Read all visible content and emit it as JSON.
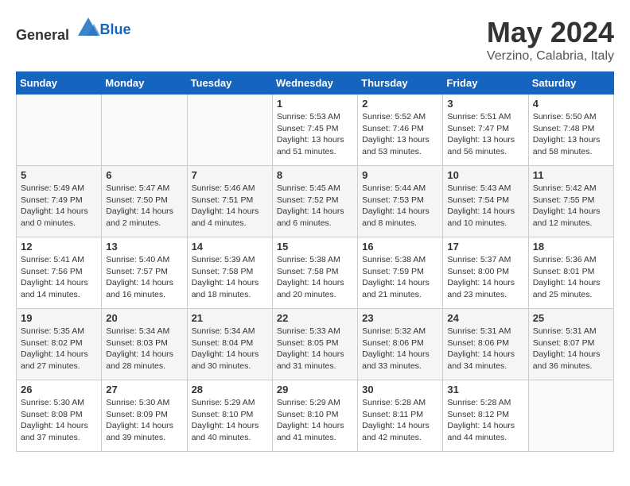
{
  "header": {
    "logo_general": "General",
    "logo_blue": "Blue",
    "month": "May 2024",
    "location": "Verzino, Calabria, Italy"
  },
  "days_of_week": [
    "Sunday",
    "Monday",
    "Tuesday",
    "Wednesday",
    "Thursday",
    "Friday",
    "Saturday"
  ],
  "weeks": [
    [
      {
        "day": "",
        "info": ""
      },
      {
        "day": "",
        "info": ""
      },
      {
        "day": "",
        "info": ""
      },
      {
        "day": "1",
        "info": "Sunrise: 5:53 AM\nSunset: 7:45 PM\nDaylight: 13 hours\nand 51 minutes."
      },
      {
        "day": "2",
        "info": "Sunrise: 5:52 AM\nSunset: 7:46 PM\nDaylight: 13 hours\nand 53 minutes."
      },
      {
        "day": "3",
        "info": "Sunrise: 5:51 AM\nSunset: 7:47 PM\nDaylight: 13 hours\nand 56 minutes."
      },
      {
        "day": "4",
        "info": "Sunrise: 5:50 AM\nSunset: 7:48 PM\nDaylight: 13 hours\nand 58 minutes."
      }
    ],
    [
      {
        "day": "5",
        "info": "Sunrise: 5:49 AM\nSunset: 7:49 PM\nDaylight: 14 hours\nand 0 minutes."
      },
      {
        "day": "6",
        "info": "Sunrise: 5:47 AM\nSunset: 7:50 PM\nDaylight: 14 hours\nand 2 minutes."
      },
      {
        "day": "7",
        "info": "Sunrise: 5:46 AM\nSunset: 7:51 PM\nDaylight: 14 hours\nand 4 minutes."
      },
      {
        "day": "8",
        "info": "Sunrise: 5:45 AM\nSunset: 7:52 PM\nDaylight: 14 hours\nand 6 minutes."
      },
      {
        "day": "9",
        "info": "Sunrise: 5:44 AM\nSunset: 7:53 PM\nDaylight: 14 hours\nand 8 minutes."
      },
      {
        "day": "10",
        "info": "Sunrise: 5:43 AM\nSunset: 7:54 PM\nDaylight: 14 hours\nand 10 minutes."
      },
      {
        "day": "11",
        "info": "Sunrise: 5:42 AM\nSunset: 7:55 PM\nDaylight: 14 hours\nand 12 minutes."
      }
    ],
    [
      {
        "day": "12",
        "info": "Sunrise: 5:41 AM\nSunset: 7:56 PM\nDaylight: 14 hours\nand 14 minutes."
      },
      {
        "day": "13",
        "info": "Sunrise: 5:40 AM\nSunset: 7:57 PM\nDaylight: 14 hours\nand 16 minutes."
      },
      {
        "day": "14",
        "info": "Sunrise: 5:39 AM\nSunset: 7:58 PM\nDaylight: 14 hours\nand 18 minutes."
      },
      {
        "day": "15",
        "info": "Sunrise: 5:38 AM\nSunset: 7:58 PM\nDaylight: 14 hours\nand 20 minutes."
      },
      {
        "day": "16",
        "info": "Sunrise: 5:38 AM\nSunset: 7:59 PM\nDaylight: 14 hours\nand 21 minutes."
      },
      {
        "day": "17",
        "info": "Sunrise: 5:37 AM\nSunset: 8:00 PM\nDaylight: 14 hours\nand 23 minutes."
      },
      {
        "day": "18",
        "info": "Sunrise: 5:36 AM\nSunset: 8:01 PM\nDaylight: 14 hours\nand 25 minutes."
      }
    ],
    [
      {
        "day": "19",
        "info": "Sunrise: 5:35 AM\nSunset: 8:02 PM\nDaylight: 14 hours\nand 27 minutes."
      },
      {
        "day": "20",
        "info": "Sunrise: 5:34 AM\nSunset: 8:03 PM\nDaylight: 14 hours\nand 28 minutes."
      },
      {
        "day": "21",
        "info": "Sunrise: 5:34 AM\nSunset: 8:04 PM\nDaylight: 14 hours\nand 30 minutes."
      },
      {
        "day": "22",
        "info": "Sunrise: 5:33 AM\nSunset: 8:05 PM\nDaylight: 14 hours\nand 31 minutes."
      },
      {
        "day": "23",
        "info": "Sunrise: 5:32 AM\nSunset: 8:06 PM\nDaylight: 14 hours\nand 33 minutes."
      },
      {
        "day": "24",
        "info": "Sunrise: 5:31 AM\nSunset: 8:06 PM\nDaylight: 14 hours\nand 34 minutes."
      },
      {
        "day": "25",
        "info": "Sunrise: 5:31 AM\nSunset: 8:07 PM\nDaylight: 14 hours\nand 36 minutes."
      }
    ],
    [
      {
        "day": "26",
        "info": "Sunrise: 5:30 AM\nSunset: 8:08 PM\nDaylight: 14 hours\nand 37 minutes."
      },
      {
        "day": "27",
        "info": "Sunrise: 5:30 AM\nSunset: 8:09 PM\nDaylight: 14 hours\nand 39 minutes."
      },
      {
        "day": "28",
        "info": "Sunrise: 5:29 AM\nSunset: 8:10 PM\nDaylight: 14 hours\nand 40 minutes."
      },
      {
        "day": "29",
        "info": "Sunrise: 5:29 AM\nSunset: 8:10 PM\nDaylight: 14 hours\nand 41 minutes."
      },
      {
        "day": "30",
        "info": "Sunrise: 5:28 AM\nSunset: 8:11 PM\nDaylight: 14 hours\nand 42 minutes."
      },
      {
        "day": "31",
        "info": "Sunrise: 5:28 AM\nSunset: 8:12 PM\nDaylight: 14 hours\nand 44 minutes."
      },
      {
        "day": "",
        "info": ""
      }
    ]
  ]
}
